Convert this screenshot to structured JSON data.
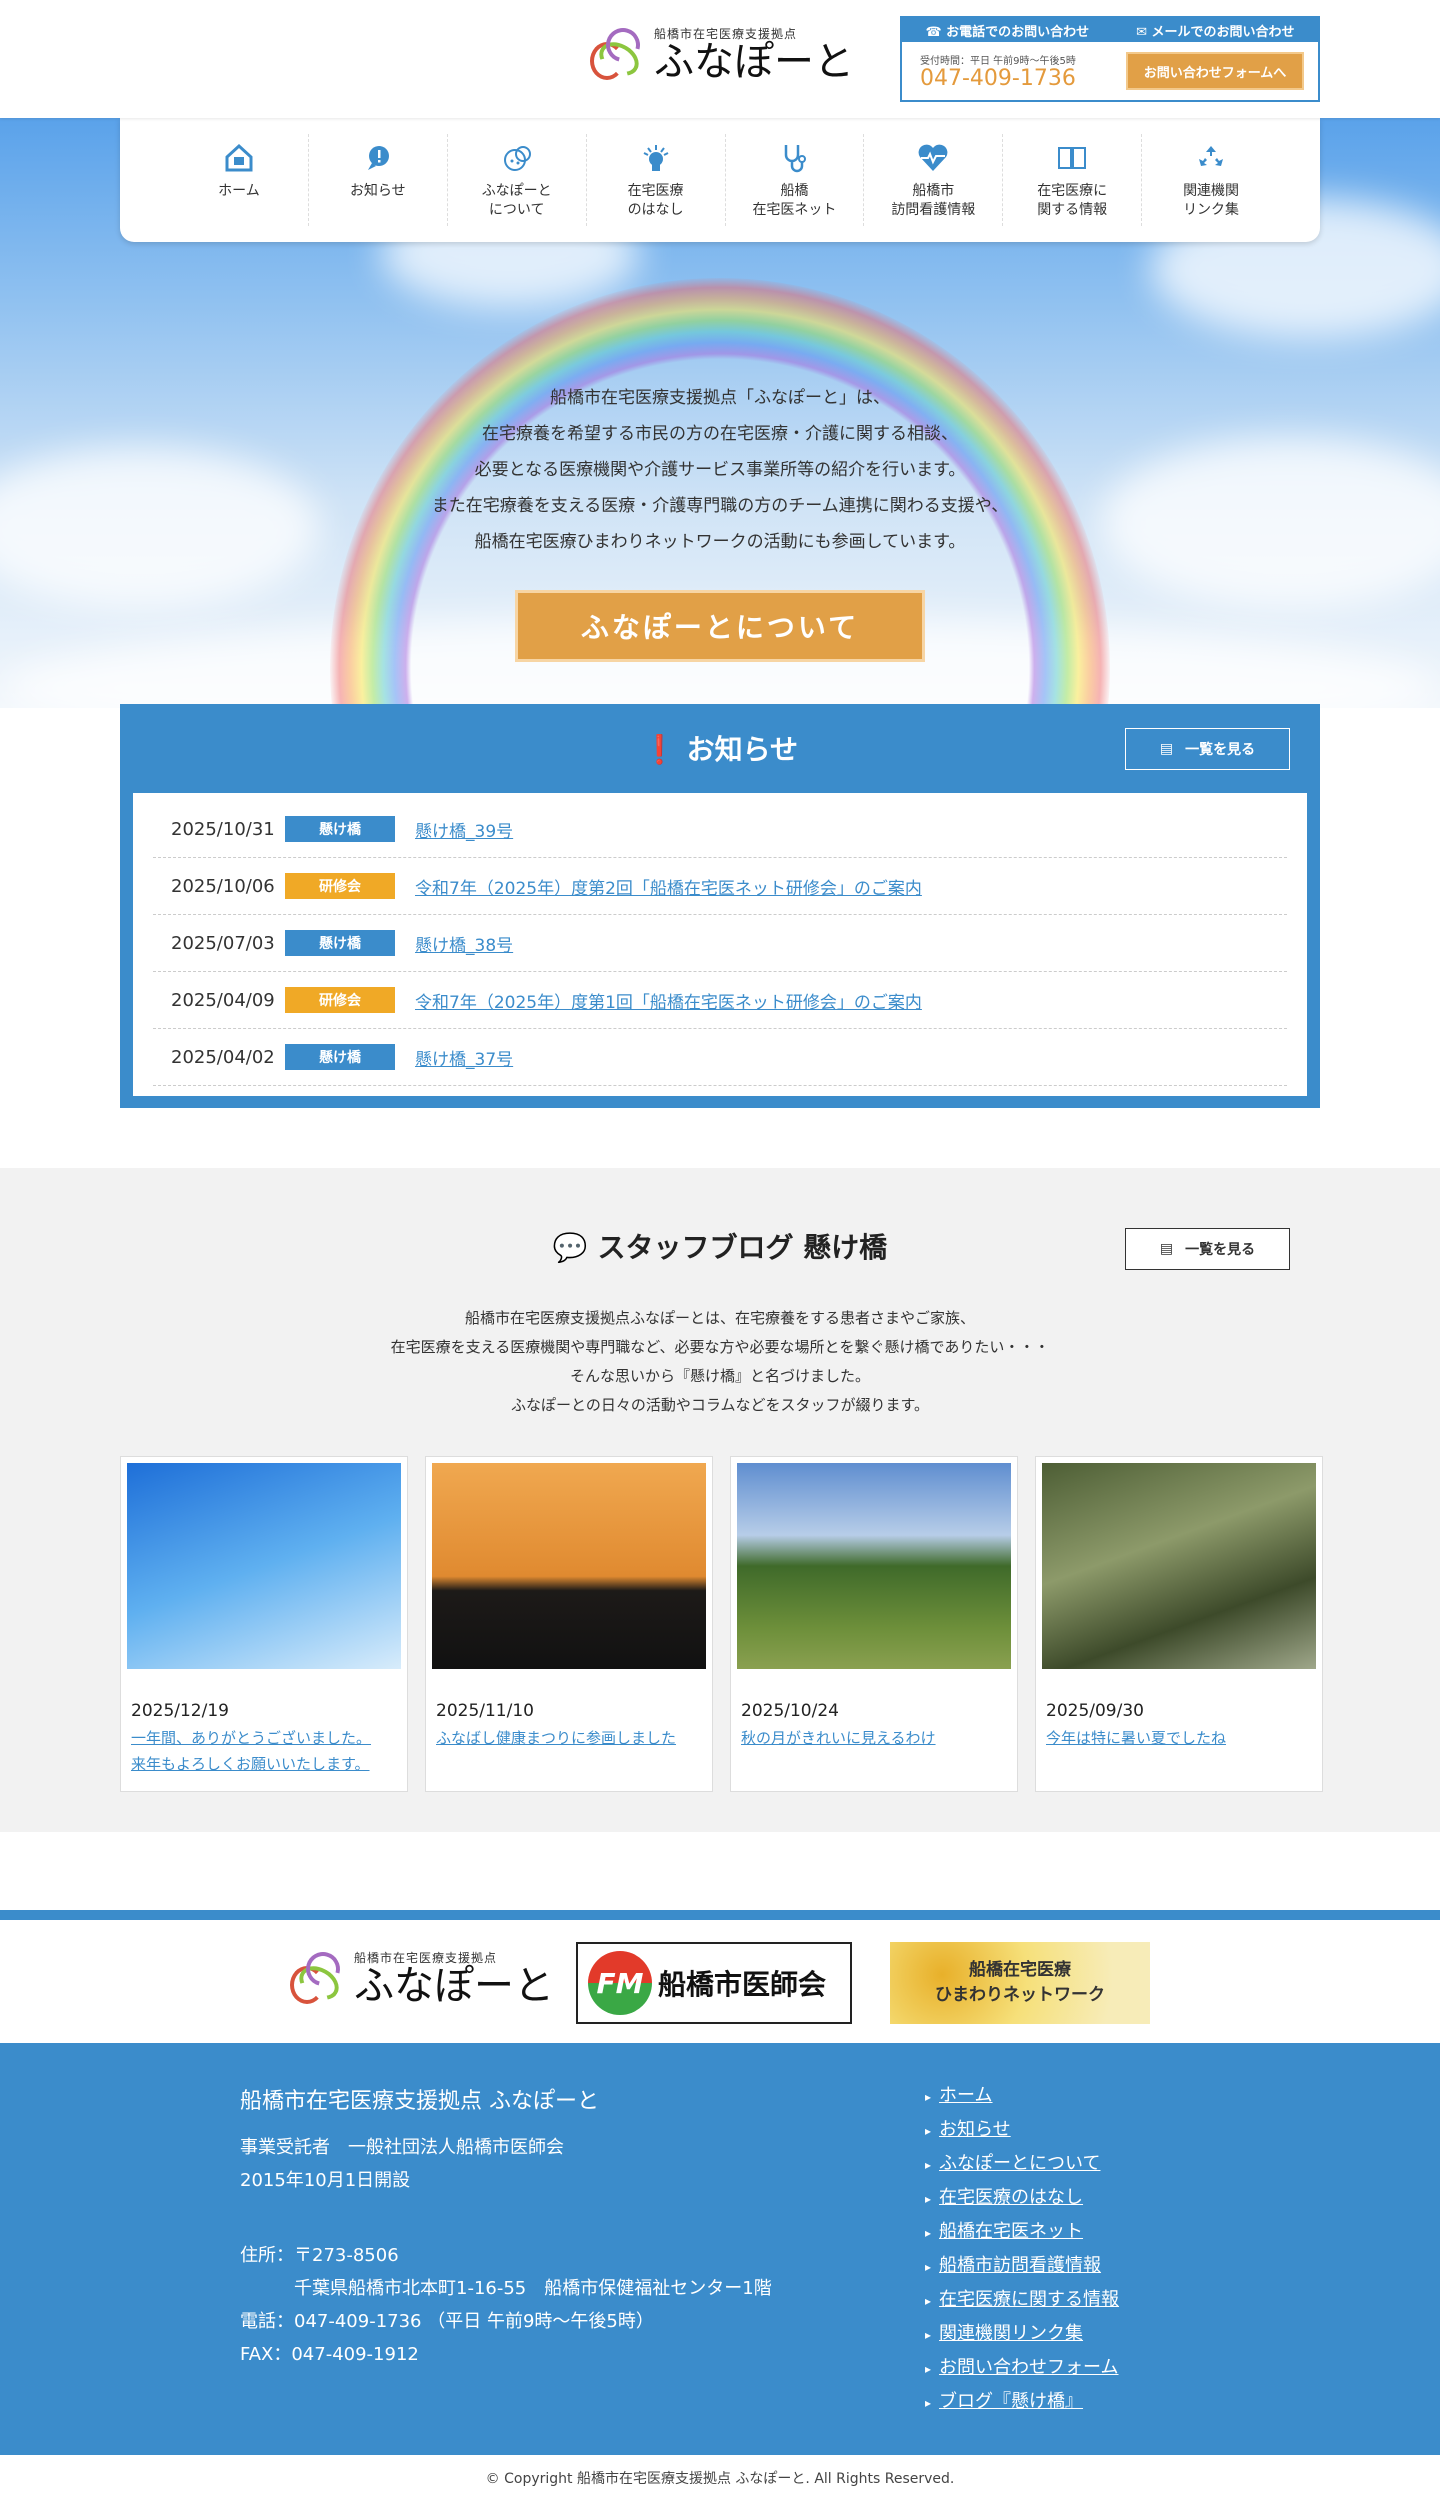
{
  "header": {
    "logo_sub": "船橋市在宅医療支援拠点",
    "logo_main": "ふなぽーと",
    "contact": {
      "phone_label": "☎ お電話でのお問い合わせ",
      "mail_label": "✉ メールでのお問い合わせ",
      "hours": "受付時間：平日 午前9時〜午後5時",
      "phone": "047-409-1736",
      "form_button": "お問い合わせフォームへ"
    }
  },
  "nav": [
    {
      "label": "ホーム",
      "icon": "home-icon"
    },
    {
      "label": "お知らせ",
      "icon": "notice-icon"
    },
    {
      "label": "ふなぽーと\nについて",
      "icon": "logo-icon"
    },
    {
      "label": "在宅医療\nのはなし",
      "icon": "lightbulb-icon"
    },
    {
      "label": "船橋\n在宅医ネット",
      "icon": "stethoscope-icon"
    },
    {
      "label": "船橋市\n訪問看護情報",
      "icon": "heart-icon"
    },
    {
      "label": "在宅医療に\n関する情報",
      "icon": "book-icon"
    },
    {
      "label": "関連機関\nリンク集",
      "icon": "recycle-icon"
    }
  ],
  "hero": {
    "lines": [
      "船橋市在宅医療支援拠点「ふなぽーと」は、",
      "在宅療養を希望する市民の方の在宅医療・介護に関する相談、",
      "必要となる医療機関や介護サービス事業所等の紹介を行います。",
      "また在宅療養を支える医療・介護専門職の方のチーム連携に関わる支援や、",
      "船橋在宅医療ひまわりネットワークの活動にも参画しています。"
    ],
    "button": "ふなぽーとについて"
  },
  "news": {
    "title": "お知らせ",
    "list_button": "一覧を見る",
    "colors": {
      "kakehashi": "#3b8ccb",
      "kenshu": "#f0a926"
    },
    "items": [
      {
        "date": "2025/10/31",
        "tag": "懸け橋",
        "tag_type": "kakehashi",
        "title": "懸け橋_39号"
      },
      {
        "date": "2025/10/06",
        "tag": "研修会",
        "tag_type": "kenshu",
        "title": "令和7年（2025年）度第2回「船橋在宅医ネット研修会」のご案内"
      },
      {
        "date": "2025/07/03",
        "tag": "懸け橋",
        "tag_type": "kakehashi",
        "title": "懸け橋_38号"
      },
      {
        "date": "2025/04/09",
        "tag": "研修会",
        "tag_type": "kenshu",
        "title": "令和7年（2025年）度第1回「船橋在宅医ネット研修会」のご案内"
      },
      {
        "date": "2025/04/02",
        "tag": "懸け橋",
        "tag_type": "kakehashi",
        "title": "懸け橋_37号"
      }
    ]
  },
  "blog": {
    "title": "スタッフブログ 懸け橋",
    "list_button": "一覧を見る",
    "desc": [
      "船橋市在宅医療支援拠点ふなぽーとは、在宅療養をする患者さまやご家族、",
      "在宅医療を支える医療機関や専門職など、必要な方や必要な場所とを繋ぐ懸け橋でありたい・・・",
      "そんな思いから『懸け橋』と名づけました。",
      "ふなぽーとの日々の活動やコラムなどをスタッフが綴ります。"
    ],
    "posts": [
      {
        "date": "2025/12/19",
        "title": "一年間、ありがとうございました。\n来年もよろしくお願いいたします。"
      },
      {
        "date": "2025/11/10",
        "title": "ふなばし健康まつりに参画しました"
      },
      {
        "date": "2025/10/24",
        "title": "秋の月がきれいに見えるわけ"
      },
      {
        "date": "2025/09/30",
        "title": "今年は特に暑い夏でしたね"
      }
    ]
  },
  "partners": {
    "funaport_sub": "船橋市在宅医療支援拠点",
    "funaport": "ふなぽーと",
    "ishikai": "船橋市医師会",
    "himawari": "船橋在宅医療\nひまわりネットワーク"
  },
  "footer": {
    "org": "船橋市在宅医療支援拠点 ふなぽーと",
    "info": [
      "事業受託者　一般社団法人船橋市医師会",
      "2015年10月1日開設",
      "",
      "住所：〒273-8506",
      "　　　千葉県船橋市北本町1-16-55　船橋市保健福祉センター1階",
      "電話：047-409-1736 （平日 午前9時〜午後5時）",
      "FAX：047-409-1912"
    ],
    "links": [
      "ホーム",
      "お知らせ",
      "ふなぽーとについて",
      "在宅医療のはなし",
      "船橋在宅医ネット",
      "船橋市訪問看護情報",
      "在宅医療に関する情報",
      "関連機関リンク集",
      "お問い合わせフォーム",
      "ブログ『懸け橋』"
    ],
    "copyright": "© Copyright 船橋市在宅医療支援拠点 ふなぽーと. All Rights Reserved."
  }
}
